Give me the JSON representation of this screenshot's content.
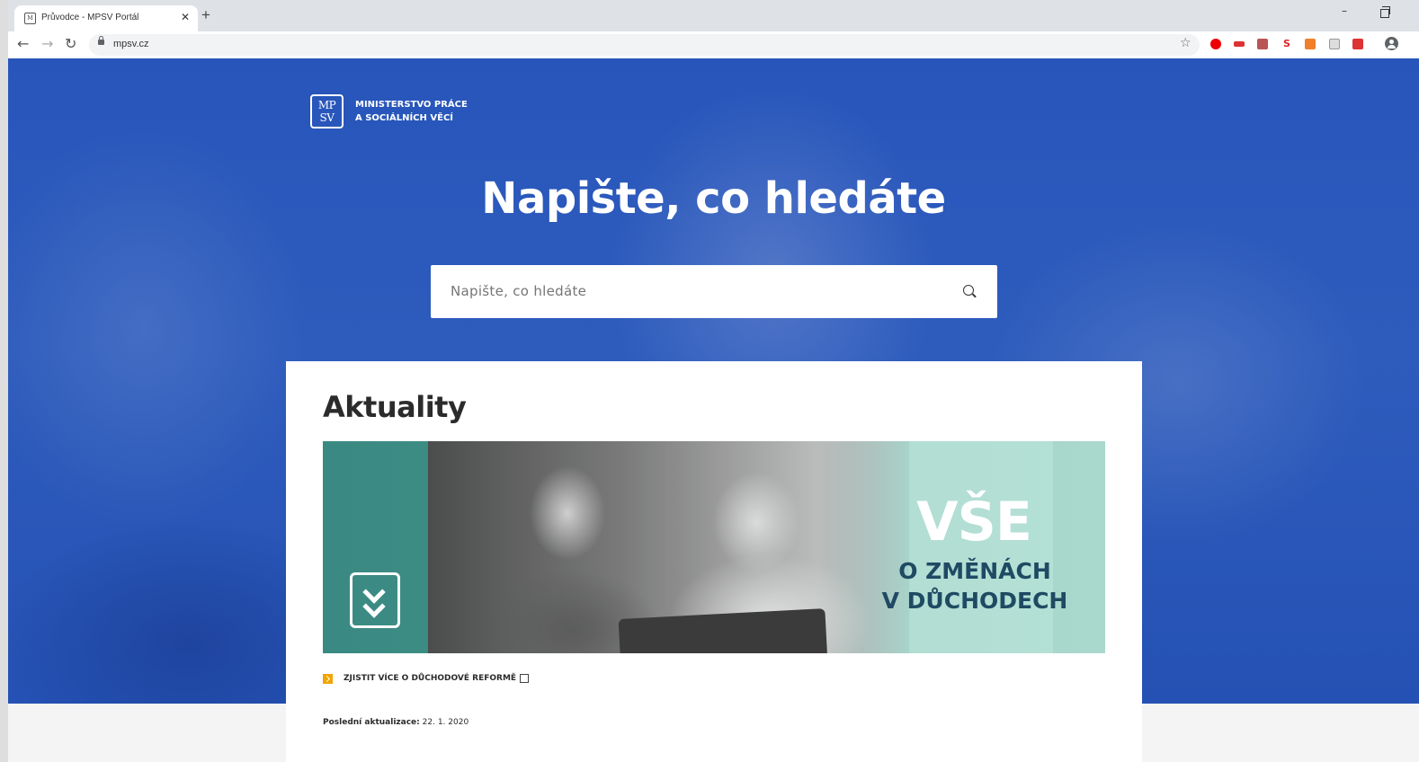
{
  "browser": {
    "tab_title": "Průvodce - MPSV Portál",
    "tab_close": "✕",
    "new_tab": "+",
    "url": "mpsv.cz",
    "star": "☆",
    "min": "–",
    "back": "←",
    "forward": "→",
    "reload": "↻"
  },
  "header": {
    "logo_mark_top": "MP",
    "logo_mark_bottom": "SV",
    "logo_line1": "MINISTERSTVO PRÁCE",
    "logo_line2": "A SOCIÁLNÍCH VĚCÍ"
  },
  "hero": {
    "title": "Napište, co hledáte",
    "search_placeholder": "Napište, co hledáte"
  },
  "news": {
    "heading": "Aktuality",
    "banner_big": "VŠE",
    "banner_line1": "O ZMĚNÁCH",
    "banner_line2": "V DŮCHODECH",
    "link_label": "ZJISTIT VÍCE O DŮCHODOVÉ REFORMĚ",
    "updated_label": "Poslední aktualizace:",
    "updated_date": "22. 1. 2020"
  },
  "colors": {
    "hero_blue": "#2b59bb",
    "accent": "#f0a500",
    "banner_teal": "#a9d8cd"
  }
}
